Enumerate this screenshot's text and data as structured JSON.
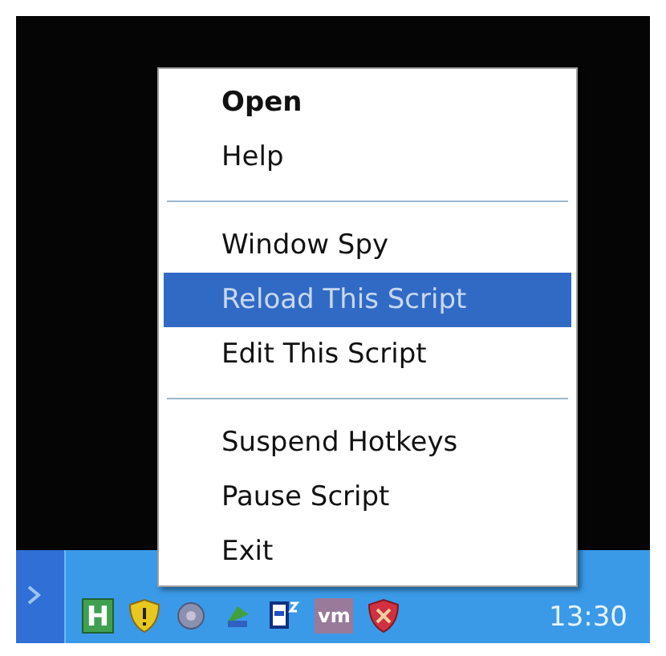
{
  "menu": {
    "items": [
      {
        "kind": "item",
        "label": "Open",
        "default": true,
        "selected": false
      },
      {
        "kind": "item",
        "label": "Help",
        "default": false,
        "selected": false
      },
      {
        "kind": "separator"
      },
      {
        "kind": "item",
        "label": "Window Spy",
        "default": false,
        "selected": false
      },
      {
        "kind": "item",
        "label": "Reload This Script",
        "default": false,
        "selected": true
      },
      {
        "kind": "item",
        "label": "Edit This Script",
        "default": false,
        "selected": false
      },
      {
        "kind": "separator"
      },
      {
        "kind": "item",
        "label": "Suspend Hotkeys",
        "default": false,
        "selected": false
      },
      {
        "kind": "item",
        "label": "Pause Script",
        "default": false,
        "selected": false
      },
      {
        "kind": "item",
        "label": "Exit",
        "default": false,
        "selected": false
      }
    ]
  },
  "tray": {
    "icons": [
      {
        "kind": "letter",
        "label": "H"
      },
      {
        "kind": "shield"
      },
      {
        "kind": "disc"
      },
      {
        "kind": "network"
      },
      {
        "kind": "monitor"
      },
      {
        "kind": "letter_wide",
        "label": "vm"
      },
      {
        "kind": "shield_red"
      }
    ],
    "clock": "13:30"
  }
}
